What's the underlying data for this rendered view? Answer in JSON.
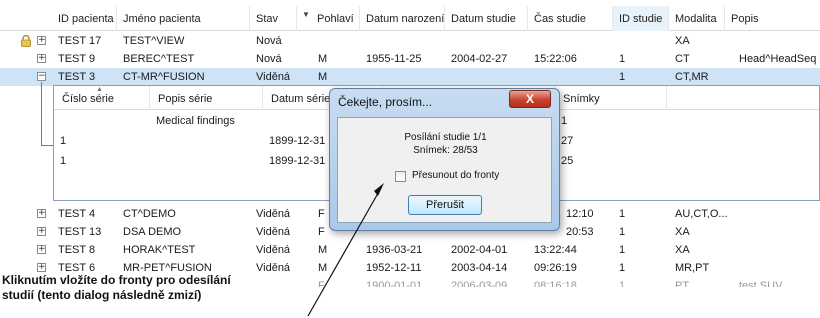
{
  "columns": [
    "ID pacienta",
    "Jméno pacienta",
    "Stav",
    "Pohlaví",
    "Datum narození",
    "Datum studie",
    "Čas studie",
    "ID studie",
    "Modalita",
    "Popis"
  ],
  "rows": [
    {
      "expander": "+",
      "id": "TEST 17",
      "name": "TEST^VIEW",
      "status": "Nová",
      "sex": "",
      "birth": "",
      "date": "",
      "time": "",
      "study_id": "",
      "modality": "XA",
      "desc": "",
      "locked": true
    },
    {
      "expander": "+",
      "id": "TEST 9",
      "name": "BEREC^TEST",
      "status": "Nová",
      "sex": "M",
      "birth": "1955-11-25",
      "date": "2004-02-27",
      "time": "15:22:06",
      "study_id": "1",
      "modality": "CT",
      "desc": "Head^HeadSeq"
    },
    {
      "expander": "−",
      "id": "TEST 3",
      "name": "CT-MR^FUSION",
      "status": "Viděná",
      "sex": "M",
      "birth": "",
      "date": "",
      "time": "",
      "study_id": "1",
      "modality": "CT,MR",
      "desc": "",
      "selected": true
    }
  ],
  "sub_table": {
    "columns": [
      "Číslo série",
      "Popis série",
      "Datum série",
      "",
      "Snímky"
    ],
    "rows": [
      {
        "num": "",
        "desc": "Medical findings",
        "date": "",
        "images": "1"
      },
      {
        "num": "1",
        "desc": "",
        "date": "1899-12-31",
        "images": "27"
      },
      {
        "num": "1",
        "desc": "",
        "date": "1899-12-31",
        "images": "25"
      }
    ]
  },
  "rows_after": [
    {
      "expander": "+",
      "id": "TEST 4",
      "name": "CT^DEMO",
      "status": "Viděná",
      "sex": "F",
      "birth": "",
      "date": "",
      "time": "12:10",
      "study_id": "1",
      "modality": "AU,CT,O...",
      "desc": ""
    },
    {
      "expander": "+",
      "id": "TEST 13",
      "name": "DSA DEMO",
      "status": "Viděná",
      "sex": "F",
      "birth": "",
      "date": "",
      "time": "20:53",
      "study_id": "1",
      "modality": "XA",
      "desc": ""
    },
    {
      "expander": "+",
      "id": "TEST 8",
      "name": "HORAK^TEST",
      "status": "Viděná",
      "sex": "M",
      "birth": "1936-03-21",
      "date": "2002-04-01",
      "time": "13:22:44",
      "study_id": "1",
      "modality": "XA",
      "desc": ""
    },
    {
      "expander": "+",
      "id": "TEST 6",
      "name": "MR-PET^FUSION",
      "status": "Viděná",
      "sex": "M",
      "birth": "1952-12-11",
      "date": "2003-04-14",
      "time": "09:26:19",
      "study_id": "1",
      "modality": "MR,PT",
      "desc": ""
    },
    {
      "expander": "",
      "id": "",
      "name": "",
      "status": "",
      "sex": "F",
      "birth": "1900-01-01",
      "date": "2006-03-09",
      "time": "08:16:18",
      "study_id": "1",
      "modality": "PT",
      "desc": "test SUV",
      "faded": true
    }
  ],
  "dialog": {
    "title": "Čekejte, prosím...",
    "close_label": "X",
    "line1": "Posílání studie 1/1",
    "line2": "Snímek: 28/53",
    "checkbox_label": "Přesunout do fronty",
    "checkbox_checked": false,
    "button_label": "Přerušit"
  },
  "annotation": {
    "line1": "Kliknutím vložíte do fronty pro odesílání",
    "line2": "studií (tento dialog následně zmizí)"
  },
  "colors": {
    "selected_row": "#cfe3f6",
    "dialog_frame": "#aac8e8",
    "close_button": "#c8422f"
  }
}
